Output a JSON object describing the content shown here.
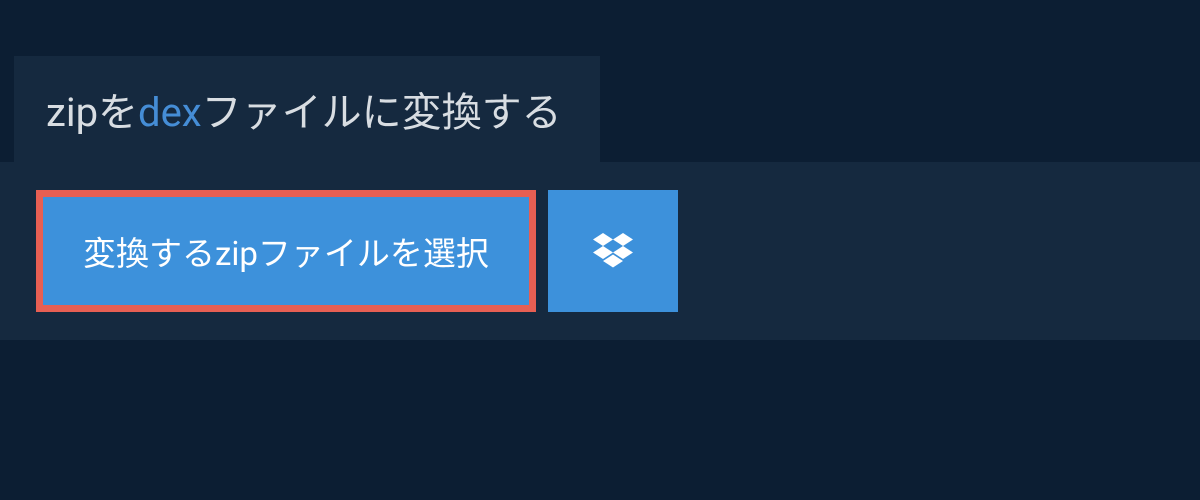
{
  "header": {
    "text_before": "zipを",
    "highlighted": "dex",
    "text_after": "ファイルに変換する"
  },
  "buttons": {
    "select_file_label": "変換するzipファイルを選択"
  },
  "colors": {
    "background_dark": "#0c1e33",
    "panel": "#15293f",
    "button_primary": "#3d91db",
    "button_border_highlight": "#e75f53",
    "text_light": "#d8dde2",
    "text_highlight": "#458dd6"
  }
}
